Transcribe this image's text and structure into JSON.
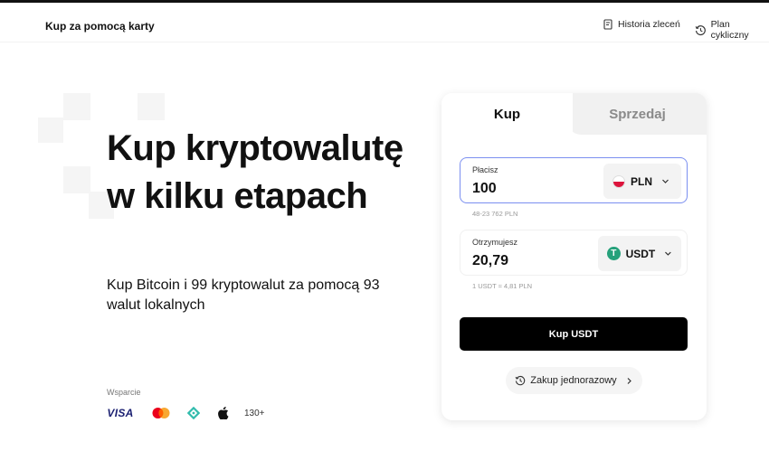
{
  "header": {
    "title": "Kup za pomocą karty",
    "orders_link": "Historia zleceń",
    "recurring_link": "Plan cykliczny"
  },
  "hero": {
    "title": "Kup kryptowalutę w kilku etapach",
    "subtitle": "Kup Bitcoin i 99 kryptowalut za pomocą 93 walut lokalnych"
  },
  "support": {
    "label": "Wsparcie",
    "visa": "VISA",
    "more": "130+"
  },
  "card": {
    "tab_buy": "Kup",
    "tab_sell": "Sprzedaj",
    "pay": {
      "label": "Płacisz",
      "value": "100",
      "currency": "PLN",
      "hint": "48-23 762 PLN"
    },
    "receive": {
      "label": "Otrzymujesz",
      "value": "20,79",
      "currency": "USDT",
      "hint": "1 USDT ≈ 4,81 PLN"
    },
    "buy_button": "Kup USDT",
    "one_time": "Zakup jednorazowy"
  },
  "colors": {
    "accent_border": "#7b8ff0",
    "usdt_green": "#26a17b",
    "poland_red": "#dc143c",
    "button_black": "#000000"
  }
}
